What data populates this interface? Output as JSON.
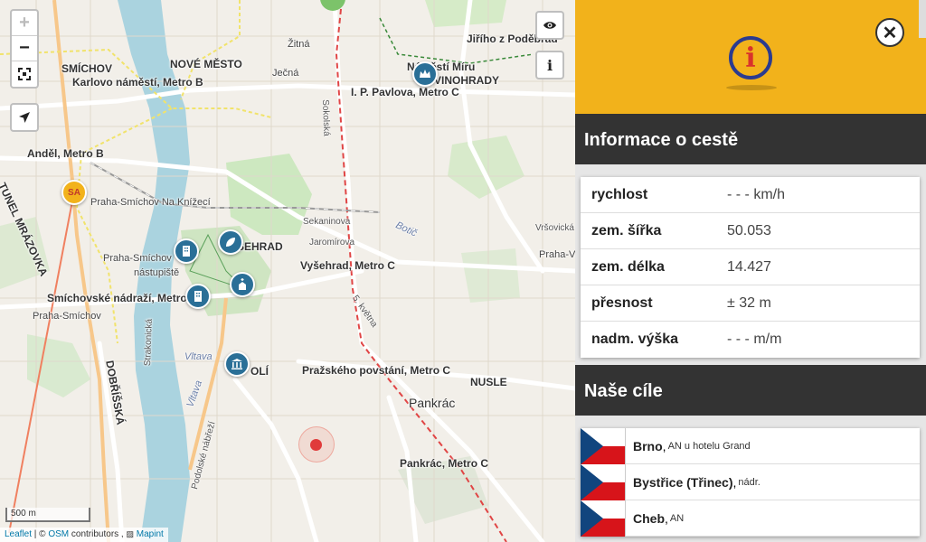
{
  "map": {
    "labels": {
      "smichov": "SMÍCHOV",
      "nove_mesto": "NOVÉ MĚSTO",
      "zitna": "Žitná",
      "jecna": "Ječná",
      "karlovo": "Karlovo náměstí, Metro B",
      "namesti_miru": "Náměstí Míru",
      "vinohrady": "VINOHRADY",
      "jiriho": "Jiřího z Poděbrad",
      "ip_pavlova": "I. P. Pavlova, Metro C",
      "andel": "Anděl, Metro B",
      "tunel": "TUNEL MRÁZOVKA",
      "smichov_knizeci": "Praha-Smíchov Na Knížecí",
      "sokolska": "Sokolská",
      "sekaninova": "Sekaninova",
      "jaromirova": "Jaromírova",
      "vrsovicka": "Vršovická",
      "botic": "Botič",
      "praha_v": "Praha-V",
      "vysehrad_label": "VYŠEHRAD",
      "vysehrad_metro": "Vyšehrad, Metro C",
      "smichov_nastupiste_1": "Praha-Smíchov",
      "smichov_nastupiste_2": "nástupiště",
      "smichovske_nadrazi": "Smíchovské nádraží, Metro",
      "praha_smichov": "Praha-Smíchov",
      "dobrisska": "DOBŘÍŠSKÁ",
      "strakonicka": "Strakonická",
      "vltava_1": "Vltava",
      "vltava_2": "Vltava",
      "podolske": "Podolské nábřeží",
      "podoli": "OLÍ",
      "prazskeho": "Pražského povstání, Metro C",
      "nusle": "NUSLE",
      "pankrac": "Pankrác",
      "pankrac_metro": "Pankrác, Metro C",
      "kvetna": "5. května"
    },
    "sa_marker": "SA",
    "zoom_in": "+",
    "zoom_out": "−",
    "scale": "500 m",
    "attribution": {
      "leaflet": "Leaflet",
      "sep": " | © ",
      "osm": "OSM",
      "contributors": " contributors , ",
      "mapint": "Mapint"
    }
  },
  "panel": {
    "info_section_title": "Informace o cestě",
    "rows": [
      {
        "label": "rychlost",
        "value": "- - - km/h"
      },
      {
        "label": "zem. šířka",
        "value": "50.053"
      },
      {
        "label": "zem. délka",
        "value": "14.427"
      },
      {
        "label": "přesnost",
        "value": "± 32 m"
      },
      {
        "label": "nadm. výška",
        "value": "- - - m/m"
      }
    ],
    "goals_section_title": "Naše cíle",
    "destinations": [
      {
        "name": "Brno",
        "sep": ",",
        "sub": "AN u hotelu Grand"
      },
      {
        "name": "Bystřice (Třinec)",
        "sep": ",",
        "sub": "nádr."
      },
      {
        "name": "Cheb",
        "sep": ",",
        "sub": "AN"
      }
    ],
    "close_symbol": "✕",
    "info_symbol": "i"
  },
  "colors": {
    "accent": "#f2b21b",
    "header_dark": "#333333",
    "poi_blue": "#2a6f97",
    "location_red": "#e03b3b"
  }
}
